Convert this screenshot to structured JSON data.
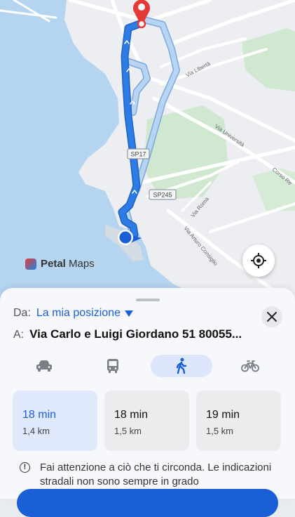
{
  "map": {
    "road_labels": [
      "SP17",
      "SP245",
      "Via Libertà",
      "Via Università",
      "Corso Re",
      "Via Roma",
      "Via Arturo Consiglio"
    ],
    "watermark": {
      "brand_bold": "Petal",
      "brand_rest": "Maps"
    },
    "locate_icon": "crosshair-icon",
    "colors": {
      "route_primary": "#2d7be5",
      "route_alt": "#b8d4f3",
      "water": "#b5d4f0",
      "land": "#eceef1",
      "park": "#cfe8cf",
      "destination_pin": "#e53935"
    }
  },
  "sheet": {
    "from_label": "Da:",
    "from_value": "La mia posizione",
    "to_label": "A:",
    "to_value": "Via Carlo e Luigi Giordano 51 80055...",
    "close_icon": "close-icon",
    "modes": [
      {
        "name": "car",
        "icon": "car-icon",
        "active": false
      },
      {
        "name": "transit",
        "icon": "bus-icon",
        "active": false
      },
      {
        "name": "walk",
        "icon": "walk-icon",
        "active": true
      },
      {
        "name": "bike",
        "icon": "bike-icon",
        "active": false
      }
    ],
    "routes": [
      {
        "time": "18 min",
        "distance": "1,4 km",
        "selected": true
      },
      {
        "time": "18 min",
        "distance": "1,5 km",
        "selected": false
      },
      {
        "time": "19 min",
        "distance": "1,5 km",
        "selected": false
      }
    ],
    "notice": "Fai attenzione a ciò che ti circonda. Le indicazioni stradali non sono sempre in grado"
  }
}
